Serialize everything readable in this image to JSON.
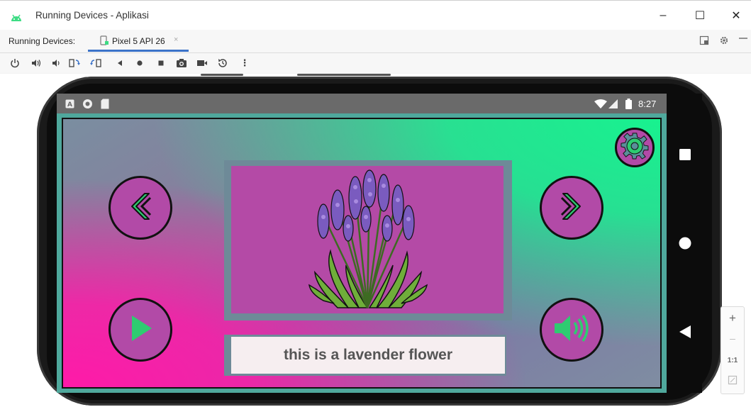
{
  "window": {
    "title": "Running Devices - Aplikasi",
    "minimize_icon": "–",
    "maximize_icon": "☐",
    "close_icon": "✕"
  },
  "tabs": {
    "label": "Running Devices:",
    "items": [
      {
        "label": "Pixel 5 API 26",
        "close": "×"
      }
    ]
  },
  "toolbar": {
    "icons": [
      "power-icon",
      "volume-up-icon",
      "volume-down-icon",
      "rotate-left-icon",
      "rotate-right-icon",
      "back-icon",
      "home-icon",
      "overview-icon",
      "screenshot-icon",
      "screen-record-icon",
      "snapshot-icon",
      "more-icon"
    ],
    "more": "⋮"
  },
  "device": {
    "status_time": "8:27",
    "app": {
      "caption": "this is a lavender flower",
      "colors": {
        "button_fill": "#b24aa7",
        "icon_green": "#2ecc71",
        "panel_border": "#6e8a98",
        "caption_bg": "#f6eef0"
      }
    }
  },
  "zoom": {
    "plus": "+",
    "minus": "–",
    "one_to_one": "1:1"
  }
}
